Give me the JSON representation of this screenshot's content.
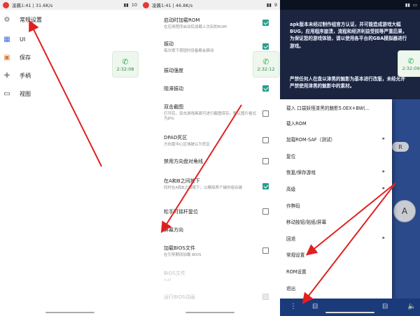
{
  "status_bars": [
    {
      "time": "凌晨1:41 | 31.6K/s",
      "right": "10"
    },
    {
      "time": "凌晨1:41 | 46.8K/s",
      "right": "9"
    },
    {
      "time": "",
      "right": ""
    }
  ],
  "clock": {
    "time": "2:32:08",
    "time_mid": "2:32:12",
    "time_right": "2:32:09"
  },
  "nav": {
    "items": [
      {
        "label": "常规设置"
      },
      {
        "label": "UI"
      },
      {
        "label": "保存"
      },
      {
        "label": "手柄"
      },
      {
        "label": "视图"
      }
    ]
  },
  "settings": {
    "items": [
      {
        "title": "启动时加载ROM",
        "sub": "在应用程序启动后加载上次玩的ROM",
        "checked": true
      },
      {
        "title": "振动",
        "sub": "每次按下按钮时设备都会振动",
        "checked": true
      },
      {
        "title": "振动强度",
        "sub": ""
      },
      {
        "title": "阻滞振动",
        "sub": "",
        "checked": true
      },
      {
        "title": "双击截图",
        "sub": "打开后，双击游戏画面可进行截图保存，默认图片格式为JPG",
        "checked": false
      },
      {
        "title": "DPAD死区",
        "sub": "方向盘中心区域被认为死区",
        "checked": false
      },
      {
        "title": "禁用方向盘对角线",
        "sub": "",
        "checked": false
      },
      {
        "title": "在A和B之间按下",
        "sub": "同时在A和B之间按下，以模拟两个键的组合键",
        "checked": true
      },
      {
        "title": "松手时摇杆复位",
        "sub": "",
        "checked": false
      },
      {
        "title": "屏幕方向",
        "sub": ""
      },
      {
        "title": "加载BIOS文件",
        "sub": "在引导期间加载 BIOS",
        "checked": false
      },
      {
        "title": "BIOS文件",
        "sub": "null"
      },
      {
        "title": "运行BIOS动画",
        "sub": ""
      }
    ]
  },
  "game_text": {
    "para1": "apk版本未经过制作组官方认证，并可能造成游戏大幅BUG，应用程序崩溃，流程和经济利益受损等严重后果，为保证您的游戏体验，请以使用各平台的GBA模拟器进行游戏。",
    "para2": "严禁任何人在盘以津黑的魅影为基本进行改版，未经允许严禁使用津黑的魅影中的素材。"
  },
  "menu": {
    "items": [
      {
        "label": "载入 口袋妖怪漆黑的魅影5.0EX+BW(...",
        "has_sub": false
      },
      {
        "label": "载入ROM",
        "has_sub": false
      },
      {
        "label": "加载ROM-SAF（测试）",
        "has_sub": true
      },
      {
        "label": "复位",
        "has_sub": false
      },
      {
        "label": "恢复/保存游戏",
        "has_sub": true
      },
      {
        "label": "高级",
        "has_sub": true
      },
      {
        "label": "作弊码",
        "has_sub": false
      },
      {
        "label": "移动按钮/贴纸/屏幕",
        "has_sub": false
      },
      {
        "label": "回退",
        "has_sub": true
      },
      {
        "label": "常规设置",
        "has_sub": false
      },
      {
        "label": "ROM设置",
        "has_sub": false
      },
      {
        "label": "退出",
        "has_sub": false
      }
    ]
  },
  "controls": {
    "a_label": "A",
    "r_label": "R"
  },
  "colors": {
    "arrow": "#e02020",
    "check": "#2a9d8f",
    "menu_bg": "#ffffff",
    "controls_bg": "#2b4a8c"
  }
}
